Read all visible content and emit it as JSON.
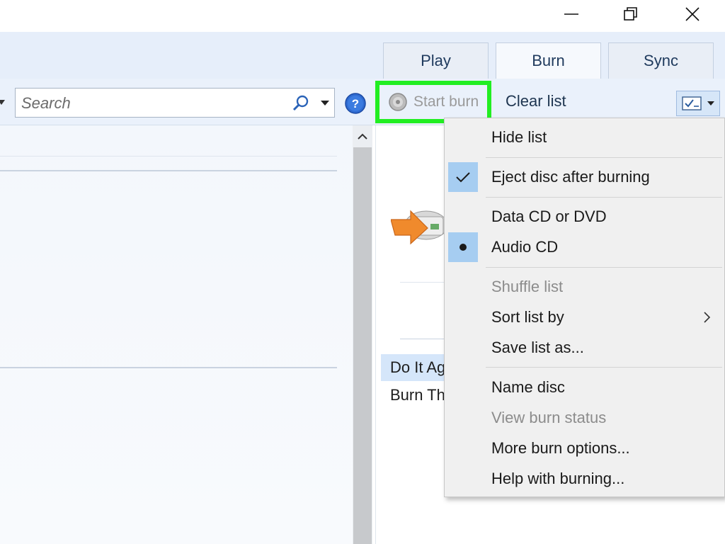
{
  "window": {
    "minimize_icon": "minimize-icon",
    "restore_icon": "restore-icon",
    "close_icon": "close-icon"
  },
  "tabs": [
    {
      "label": "Play"
    },
    {
      "label": "Burn"
    },
    {
      "label": "Sync"
    }
  ],
  "toolbar": {
    "search_placeholder": "Search",
    "start_burn_label": "Start burn",
    "clear_list_label": "Clear list",
    "highlight_color": "#22ee22"
  },
  "burn_list": {
    "songs": [
      {
        "label": "Do It Ag"
      },
      {
        "label": "Burn Th"
      }
    ]
  },
  "menu": {
    "items": [
      {
        "label": "Hide list",
        "enabled": true,
        "mark": "none"
      },
      {
        "label": "Eject disc after burning",
        "enabled": true,
        "mark": "check"
      },
      {
        "label": "Data CD or DVD",
        "enabled": true,
        "mark": "none"
      },
      {
        "label": "Audio CD",
        "enabled": true,
        "mark": "bullet"
      },
      {
        "label": "Shuffle list",
        "enabled": false,
        "mark": "none"
      },
      {
        "label": "Sort list by",
        "enabled": true,
        "mark": "none",
        "submenu": true
      },
      {
        "label": "Save list as...",
        "enabled": true,
        "mark": "none"
      },
      {
        "label": "Name disc",
        "enabled": true,
        "mark": "none"
      },
      {
        "label": "View burn status",
        "enabled": false,
        "mark": "none"
      },
      {
        "label": "More burn options...",
        "enabled": true,
        "mark": "none"
      },
      {
        "label": "Help with burning...",
        "enabled": true,
        "mark": "none"
      }
    ]
  }
}
